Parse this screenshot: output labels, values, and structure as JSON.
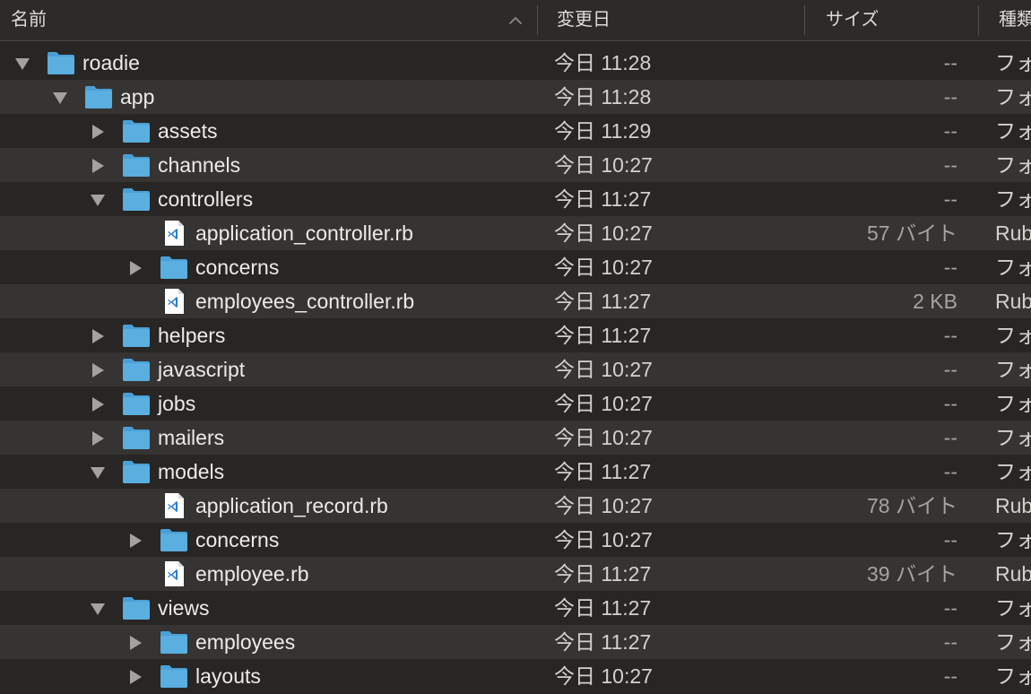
{
  "header": {
    "name_label": "名前",
    "date_label": "変更日",
    "size_label": "サイズ",
    "kind_label": "種類"
  },
  "colors": {
    "folder": "#5aaee0",
    "folder_tab": "#4a9fd6",
    "row_alt": "#363432",
    "row_base": "#282624",
    "vscode_blue": "#2b7bd6"
  },
  "rows": [
    {
      "name": "roadie",
      "date": "今日 11:28",
      "size": "--",
      "kind": "フォ",
      "type": "folder",
      "expanded": true
    },
    {
      "name": "app",
      "date": "今日 11:28",
      "size": "--",
      "kind": "フォ",
      "type": "folder",
      "expanded": true
    },
    {
      "name": "assets",
      "date": "今日 11:29",
      "size": "--",
      "kind": "フォ",
      "type": "folder",
      "expanded": false
    },
    {
      "name": "channels",
      "date": "今日 10:27",
      "size": "--",
      "kind": "フォ",
      "type": "folder",
      "expanded": false
    },
    {
      "name": "controllers",
      "date": "今日 11:27",
      "size": "--",
      "kind": "フォ",
      "type": "folder",
      "expanded": true
    },
    {
      "name": "application_controller.rb",
      "date": "今日 10:27",
      "size": "57 バイト",
      "kind": "Rub",
      "type": "file"
    },
    {
      "name": "concerns",
      "date": "今日 10:27",
      "size": "--",
      "kind": "フォ",
      "type": "folder",
      "expanded": false
    },
    {
      "name": "employees_controller.rb",
      "date": "今日 11:27",
      "size": "2 KB",
      "kind": "Rub",
      "type": "file"
    },
    {
      "name": "helpers",
      "date": "今日 11:27",
      "size": "--",
      "kind": "フォ",
      "type": "folder",
      "expanded": false
    },
    {
      "name": "javascript",
      "date": "今日 10:27",
      "size": "--",
      "kind": "フォ",
      "type": "folder",
      "expanded": false
    },
    {
      "name": "jobs",
      "date": "今日 10:27",
      "size": "--",
      "kind": "フォ",
      "type": "folder",
      "expanded": false
    },
    {
      "name": "mailers",
      "date": "今日 10:27",
      "size": "--",
      "kind": "フォ",
      "type": "folder",
      "expanded": false
    },
    {
      "name": "models",
      "date": "今日 11:27",
      "size": "--",
      "kind": "フォ",
      "type": "folder",
      "expanded": true
    },
    {
      "name": "application_record.rb",
      "date": "今日 10:27",
      "size": "78 バイト",
      "kind": "Rub",
      "type": "file"
    },
    {
      "name": "concerns",
      "date": "今日 10:27",
      "size": "--",
      "kind": "フォ",
      "type": "folder",
      "expanded": false
    },
    {
      "name": "employee.rb",
      "date": "今日 11:27",
      "size": "39 バイト",
      "kind": "Rub",
      "type": "file"
    },
    {
      "name": "views",
      "date": "今日 11:27",
      "size": "--",
      "kind": "フォ",
      "type": "folder",
      "expanded": true
    },
    {
      "name": "employees",
      "date": "今日 11:27",
      "size": "--",
      "kind": "フォ",
      "type": "folder",
      "expanded": false
    },
    {
      "name": "layouts",
      "date": "今日 10:27",
      "size": "--",
      "kind": "フォ",
      "type": "folder",
      "expanded": false
    }
  ]
}
